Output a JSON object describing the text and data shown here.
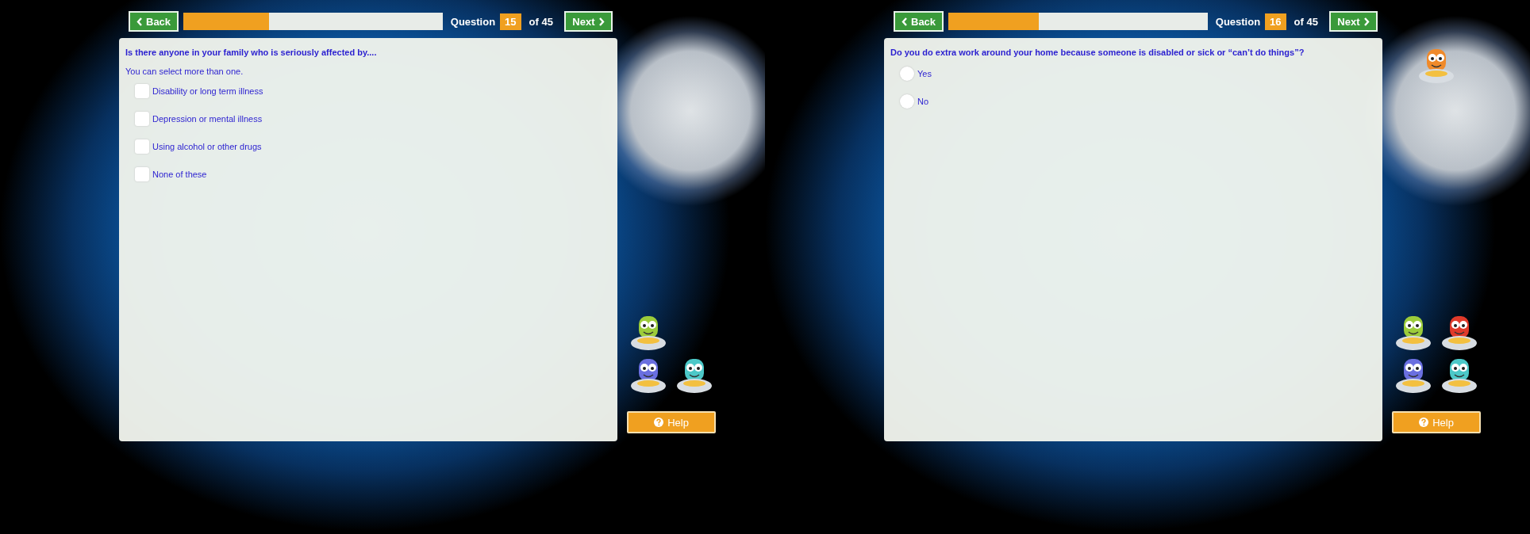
{
  "screens": [
    {
      "back": "Back",
      "next": "Next",
      "progress": {
        "level": 0.33
      },
      "question_label": "Question",
      "question_number": "15",
      "question_total": "of 45",
      "question": "Is there anyone in your family who is seriously affected by....",
      "instruction": "You can select more than one.",
      "options": [
        {
          "kind": "checkbox",
          "label": "Disability or long term illness",
          "checked": false
        },
        {
          "kind": "checkbox",
          "label": "Depression or mental illness",
          "checked": false
        },
        {
          "kind": "checkbox",
          "label": "Using alcohol or other drugs",
          "checked": false
        },
        {
          "kind": "checkbox",
          "label": "None of these",
          "checked": false
        }
      ],
      "mascots": [
        {
          "kind": "green"
        },
        {
          "kind": "blue"
        },
        {
          "kind": "cyan"
        }
      ],
      "help": "Help"
    },
    {
      "back": "Back",
      "next": "Next",
      "progress": {
        "level": 0.35
      },
      "question_label": "Question",
      "question_number": "16",
      "question_total": "of 45",
      "question": "Do you do extra work around your home because someone is disabled or sick or “can’t do things”?",
      "options": [
        {
          "kind": "radio",
          "label": "Yes",
          "selected": false
        },
        {
          "kind": "radio",
          "label": "No",
          "selected": false
        }
      ],
      "top_mascot": {
        "kind": "orange"
      },
      "mascots": [
        {
          "kind": "green"
        },
        {
          "kind": "red"
        },
        {
          "kind": "blue"
        },
        {
          "kind": "cyan"
        }
      ],
      "help": "Help"
    }
  ]
}
